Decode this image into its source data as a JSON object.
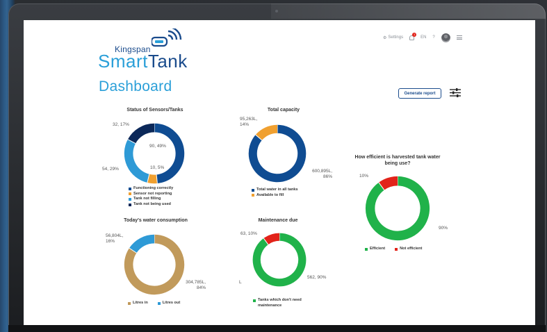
{
  "header": {
    "brand_top": "Kingspan",
    "brand_smart": "Smart",
    "brand_tank": "Tank",
    "nav": {
      "settings_label": "Settings",
      "notification_count": "1",
      "language": "EN"
    }
  },
  "page": {
    "title": "Dashboard",
    "generate_report_label": "Generate report"
  },
  "colors": {
    "dark_navy": "#0b2859",
    "navy": "#0f4c92",
    "orange": "#f0a030",
    "light_blue": "#2e9ad6",
    "tan": "#c19a5b",
    "green": "#20b24a",
    "red": "#e2231a"
  },
  "charts": {
    "sensors": {
      "title": "Status of Sensors/Tanks",
      "labels": [
        "90, 49%",
        "10, 5%",
        "54, 29%",
        "32, 17%"
      ],
      "legend": [
        "Functioning correctly",
        "Sensor not reporting",
        "Tank not filling",
        "Tank not being used"
      ]
    },
    "capacity": {
      "title": "Total capacity",
      "labels": [
        "600,895L, 86%",
        "95,263L, 14%"
      ],
      "legend": [
        "Total water in all tanks",
        "Available to fill"
      ]
    },
    "efficiency": {
      "title": "How efficient is harvested tank water being use?",
      "labels": [
        "90%",
        "10%"
      ],
      "legend": [
        "Efficient",
        "Not efficient"
      ]
    },
    "consumption": {
      "title": "Today's water consumption",
      "labels": [
        "304,785L, 84%",
        "56,804L, 16%"
      ],
      "legend": [
        "Litres in",
        "Litres out"
      ]
    },
    "maintenance": {
      "title": "Maintenance due",
      "labels": [
        "562, 90%",
        "63, 10%"
      ],
      "legend": [
        "Tanks which don't need maintenance"
      ],
      "stray": "L"
    }
  },
  "chart_data": [
    {
      "type": "pie",
      "title": "Status of Sensors/Tanks",
      "categories": [
        "Functioning correctly",
        "Sensor not reporting",
        "Tank not filling",
        "Tank not being used"
      ],
      "values": [
        90,
        10,
        54,
        32
      ],
      "percent": [
        49,
        5,
        29,
        17
      ],
      "colors": [
        "#0f4c92",
        "#f0a030",
        "#2e9ad6",
        "#0b2859"
      ]
    },
    {
      "type": "pie",
      "title": "Total capacity",
      "categories": [
        "Total water in all tanks",
        "Available to fill"
      ],
      "values": [
        600895,
        95263
      ],
      "percent": [
        86,
        14
      ],
      "colors": [
        "#0f4c92",
        "#f0a030"
      ]
    },
    {
      "type": "pie",
      "title": "How efficient is harvested tank water being use?",
      "categories": [
        "Efficient",
        "Not efficient"
      ],
      "values": [
        90,
        10
      ],
      "percent": [
        90,
        10
      ],
      "colors": [
        "#20b24a",
        "#e2231a"
      ]
    },
    {
      "type": "pie",
      "title": "Today's water consumption",
      "categories": [
        "Litres in",
        "Litres out"
      ],
      "values": [
        304785,
        56804
      ],
      "percent": [
        84,
        16
      ],
      "colors": [
        "#c19a5b",
        "#2e9ad6"
      ]
    },
    {
      "type": "pie",
      "title": "Maintenance due",
      "categories": [
        "Tanks which don't need maintenance",
        ""
      ],
      "values": [
        562,
        63
      ],
      "percent": [
        90,
        10
      ],
      "colors": [
        "#20b24a",
        "#e2231a"
      ]
    }
  ]
}
